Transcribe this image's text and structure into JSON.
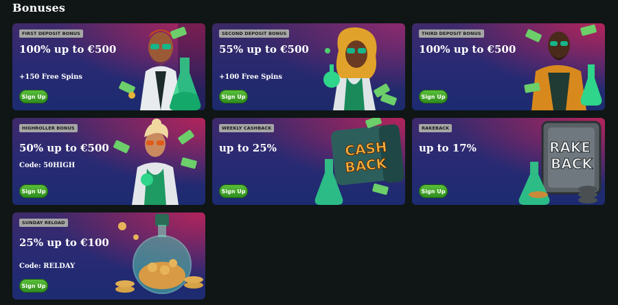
{
  "page": {
    "title": "Bonuses"
  },
  "cards": [
    {
      "badge": "FIRST DEPOSIT BONUS",
      "headline": "100% up to €500",
      "sub": "+150 Free Spins",
      "button": "Sign Up",
      "art": "scientist-man-icon"
    },
    {
      "badge": "SECOND DEPOSIT BONUS",
      "headline": "55% up to €500",
      "sub": "+100 Free Spins",
      "button": "Sign Up",
      "art": "scientist-woman-icon"
    },
    {
      "badge": "THIRD DEPOSIT BONUS",
      "headline": "100% up to €500",
      "sub": "",
      "button": "Sign Up",
      "art": "scientist-bald-icon"
    },
    {
      "badge": "HIGHROLLER BONUS",
      "headline": "50% up to €500",
      "sub": "Code: 50HIGH",
      "button": "Sign Up",
      "art": "scientist-blonde-icon"
    },
    {
      "badge": "WEEKLY CASHBACK",
      "headline": "up to 25%",
      "sub": "",
      "button": "Sign Up",
      "art": "cashback-wallet-icon",
      "art_text": [
        "CASH",
        "BACK"
      ]
    },
    {
      "badge": "RAKEBACK",
      "headline": "up to 17%",
      "sub": "",
      "button": "Sign Up",
      "art": "rakeback-safe-icon",
      "art_text": [
        "RAKE",
        "BACK"
      ]
    },
    {
      "badge": "SUNDAY RELOAD",
      "headline": "25% up to €100",
      "sub": "Code: RELDAY",
      "button": "Sign Up",
      "art": "coin-flask-icon"
    }
  ],
  "colors": {
    "background": "#0f1615",
    "signup_green": "#3fa82a",
    "badge_gray": "#a6a6a6",
    "flask_green": "#2fd58a"
  }
}
